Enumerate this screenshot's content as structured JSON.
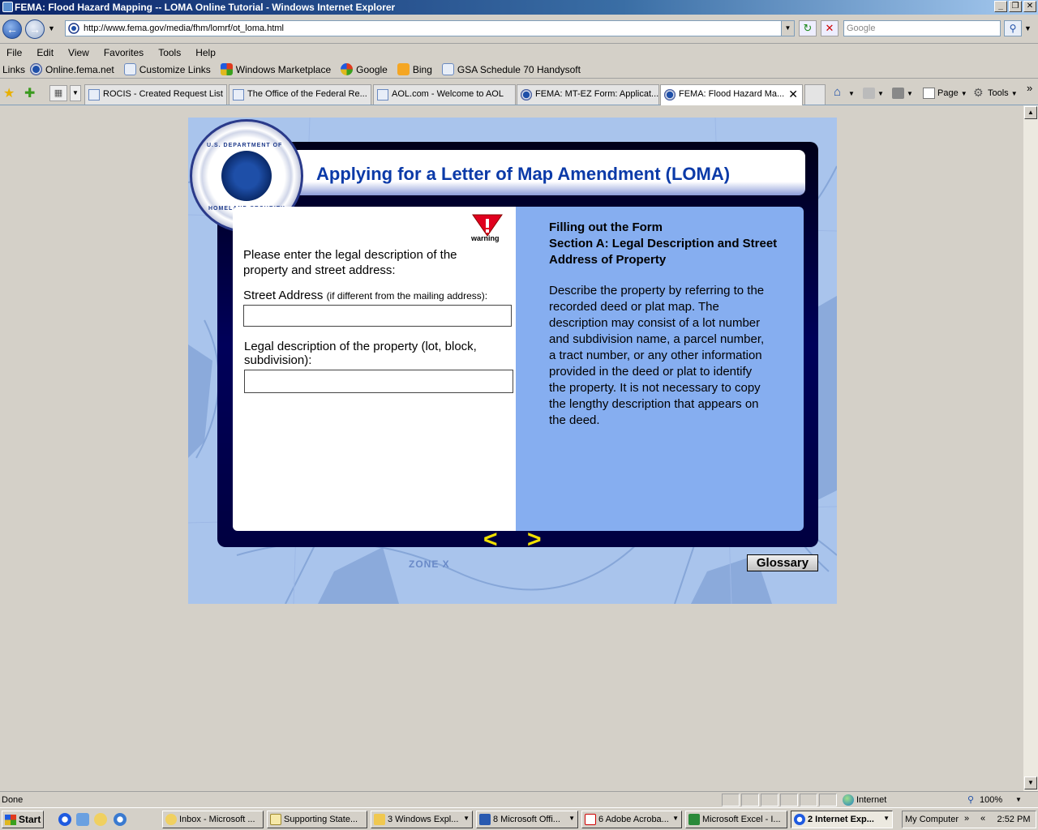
{
  "window": {
    "title": "FEMA: Flood Hazard Mapping -- LOMA Online Tutorial - Windows Internet Explorer",
    "min": "_",
    "max": "❐",
    "close": "✕"
  },
  "address": {
    "url": "http://www.fema.gov/media/fhm/lomrf/ot_loma.html",
    "search_placeholder": "Google"
  },
  "menu": [
    "File",
    "Edit",
    "View",
    "Favorites",
    "Tools",
    "Help"
  ],
  "links": {
    "label": "Links",
    "items": [
      "Online.fema.net",
      "Customize Links",
      "Windows Marketplace",
      "Google",
      "Bing",
      "GSA Schedule 70  Handysoft"
    ]
  },
  "tabs": [
    "ROCIS - Created Request List",
    "The Office of the Federal Re...",
    "AOL.com - Welcome to AOL",
    "FEMA: MT-EZ Form: Applicat...",
    "FEMA: Flood Hazard Ma..."
  ],
  "commands": {
    "page": "Page",
    "tools": "Tools",
    "more": "»"
  },
  "content": {
    "title": "Applying for a Letter of Map Amendment (LOMA)",
    "seal_top": "U.S. DEPARTMENT OF",
    "seal_bottom": "HOMELAND SECURITY",
    "warning": "warning",
    "prompt": "Please enter the legal description of the property and street address:",
    "street_label": "Street Address",
    "street_note": "(if different from the mailing address):",
    "legal_label": "Legal description of the property (lot, block, subdivision):",
    "help_title_1": "Filling out the Form",
    "help_title_2": "Section A: Legal Description and Street Address of Property",
    "help_body": "Describe the property by referring to the recorded deed or plat map. The description may consist of a lot number and subdivision name, a parcel number, a tract number, or any other information provided in the deed or plat to identify the property. It is not necessary to copy the lengthy description that appears on the deed.",
    "prev": "<",
    "next": ">",
    "glossary": "Glossary",
    "map_zone": "ZONE X"
  },
  "status": {
    "text": "Done",
    "zone": "Internet",
    "zoom": "100%"
  },
  "taskbar": {
    "start": "Start",
    "buttons": [
      "Inbox - Microsoft ...",
      "Supporting State...",
      "3 Windows Expl...",
      "8 Microsoft Offi...",
      "6 Adobe Acroba...",
      "Microsoft Excel - I...",
      "2 Internet Exp..."
    ],
    "tray_label": "My Computer",
    "tray_more": "»",
    "tray_collapse": "«",
    "clock": "2:52 PM"
  },
  "colors": {
    "title_blue": "#0b3aa8",
    "panel_blue": "#86aef0",
    "nav_yellow": "#f0e000",
    "frame_navy": "#00005a"
  }
}
